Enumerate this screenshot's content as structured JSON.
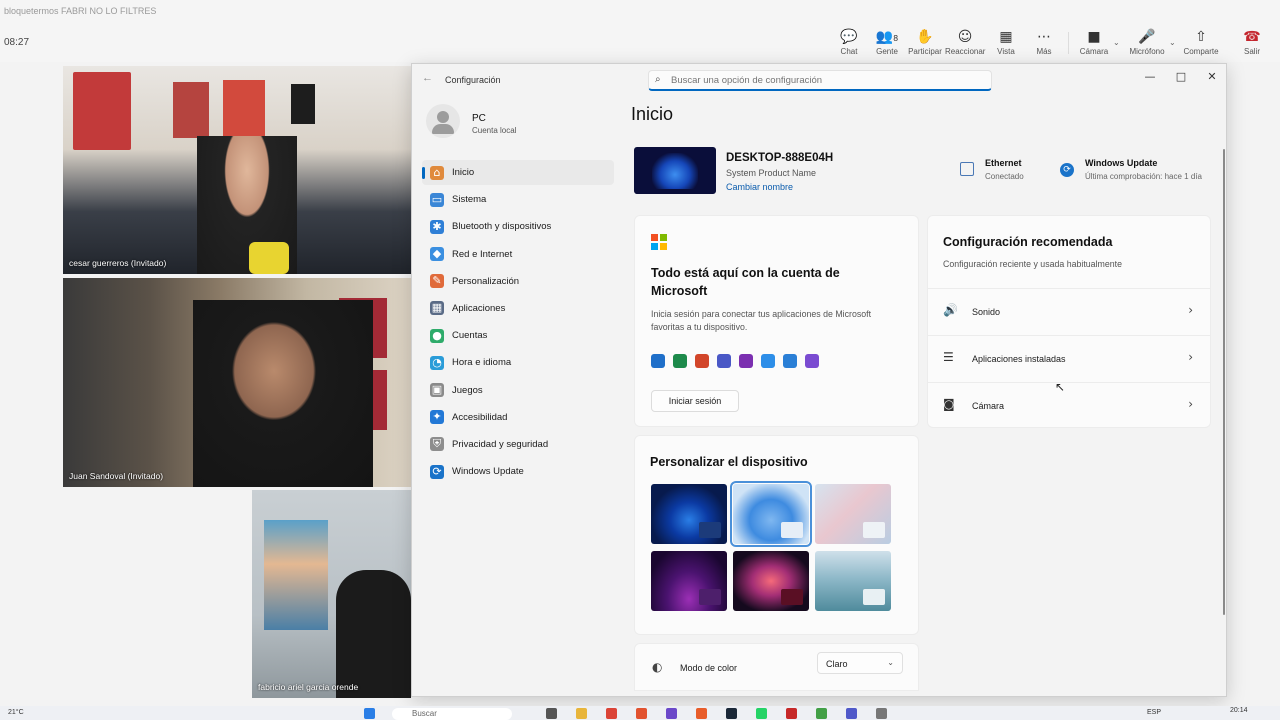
{
  "meeting": {
    "title": "bloquetermos FABRI NO LO FILTRES",
    "time": "08:27",
    "controls": [
      {
        "label": "Chat",
        "icon": "chat-icon",
        "glyph": "💬"
      },
      {
        "label": "Gente",
        "icon": "people-icon",
        "glyph": "👥",
        "count": "8"
      },
      {
        "label": "Participar",
        "icon": "raise-hand-icon",
        "glyph": "✋"
      },
      {
        "label": "Reaccionar",
        "icon": "emoji-icon",
        "glyph": "☺"
      },
      {
        "label": "Vista",
        "icon": "view-grid-icon",
        "glyph": "▦"
      },
      {
        "label": "Más",
        "icon": "more-icon",
        "glyph": "⋯"
      },
      {
        "label": "Cámara",
        "icon": "camera-icon",
        "glyph": "■"
      },
      {
        "label": "Micrófono",
        "icon": "microphone-icon",
        "glyph": "🎤"
      },
      {
        "label": "Comparte",
        "icon": "share-icon",
        "glyph": "⇧"
      },
      {
        "label": "Salir",
        "icon": "hangup-icon",
        "glyph": "☎"
      }
    ],
    "participants": [
      {
        "name": "cesar guerreros (Invitado)"
      },
      {
        "name": "Juan Sandoval (Invitado)"
      },
      {
        "name": "fabricio ariel garcia orende"
      }
    ]
  },
  "settings": {
    "app_title": "Configuración",
    "search_placeholder": "Buscar una opción de configuración",
    "user": {
      "name": "PC",
      "type": "Cuenta local"
    },
    "nav": [
      {
        "label": "Inicio",
        "icon": "home-icon",
        "color": "#e08a3c",
        "selected": true
      },
      {
        "label": "Sistema",
        "icon": "system-icon",
        "color": "#3a86d6"
      },
      {
        "label": "Bluetooth y dispositivos",
        "icon": "bluetooth-icon",
        "color": "#2f7fd6"
      },
      {
        "label": "Red e Internet",
        "icon": "network-icon",
        "color": "#3b8fe0"
      },
      {
        "label": "Personalización",
        "icon": "brush-icon",
        "color": "#e06a3a"
      },
      {
        "label": "Aplicaciones",
        "icon": "apps-icon",
        "color": "#5a6b86"
      },
      {
        "label": "Cuentas",
        "icon": "accounts-icon",
        "color": "#2eab6a"
      },
      {
        "label": "Hora e idioma",
        "icon": "time-language-icon",
        "color": "#2a9cd8"
      },
      {
        "label": "Juegos",
        "icon": "gaming-icon",
        "color": "#8a8a8a"
      },
      {
        "label": "Accesibilidad",
        "icon": "accessibility-icon",
        "color": "#2278d6"
      },
      {
        "label": "Privacidad y seguridad",
        "icon": "shield-icon",
        "color": "#8d8d8d"
      },
      {
        "label": "Windows Update",
        "icon": "windows-update-icon",
        "color": "#1a73c9"
      }
    ],
    "page_title": "Inicio",
    "device": {
      "name": "DESKTOP-888E04H",
      "model": "System Product Name",
      "rename": "Cambiar nombre"
    },
    "ethernet": {
      "label": "Ethernet",
      "status": "Conectado"
    },
    "windows_update": {
      "label": "Windows Update",
      "status": "Última comprobación: hace 1 día"
    },
    "microsoft_card": {
      "title": "Todo está aquí con la cuenta de Microsoft",
      "description": "Inicia sesión para conectar tus aplicaciones de Microsoft favoritas a tu dispositivo.",
      "button": "Iniciar sesión",
      "apps": [
        {
          "icon": "outlook-icon",
          "color": "#1f6fc9"
        },
        {
          "icon": "excel-icon",
          "color": "#1d8a4b"
        },
        {
          "icon": "powerpoint-icon",
          "color": "#d2462a"
        },
        {
          "icon": "teams-icon",
          "color": "#4a58c6"
        },
        {
          "icon": "onenote-icon",
          "color": "#7b2fb0"
        },
        {
          "icon": "onedrive-icon",
          "color": "#2d8ee8"
        },
        {
          "icon": "defender-icon",
          "color": "#2a7fd6"
        },
        {
          "icon": "clipchamp-icon",
          "color": "#7a4bd1"
        }
      ]
    },
    "recommended": {
      "title": "Configuración recomendada",
      "subtitle": "Configuración reciente y usada habitualmente",
      "items": [
        {
          "label": "Sonido",
          "icon": "speaker-icon",
          "glyph": "🔊"
        },
        {
          "label": "Aplicaciones instaladas",
          "icon": "list-icon",
          "glyph": "☰"
        },
        {
          "label": "Cámara",
          "icon": "camera-icon",
          "glyph": "◙"
        }
      ]
    },
    "personalize": {
      "title": "Personalizar el dispositivo",
      "themes": [
        {
          "name": "dark-bloom",
          "bg": "radial-gradient(ellipse at 50% 60%, #2a7ee6 0%, #0b3aa3 35%, #071a4d 70%)",
          "bar": "#1c3b7a",
          "selected": false
        },
        {
          "name": "light-bloom",
          "bg": "radial-gradient(ellipse at 50% 60%, #7fb7f0 0%, #3e8be0 40%, #cfe3f6 75%)",
          "bar": "#e6eef7",
          "selected": true
        },
        {
          "name": "flowers",
          "bg": "linear-gradient(135deg, #d6e3ef 0%, #e9c7cf 45%, #b9cde2 100%)",
          "bar": "#eef2f6",
          "selected": false
        },
        {
          "name": "glow",
          "bg": "radial-gradient(ellipse at 50% 80%, #9b2fb5 0%, #4b1370 40%, #1a0630 80%)",
          "bar": "#4d1f6b",
          "selected": false
        },
        {
          "name": "captured-motion",
          "bg": "radial-gradient(ellipse at 50% 50%, #f56a7a 0%, #a32e75 35%, #150a1e 75%)",
          "bar": "#5a0f24",
          "selected": false
        },
        {
          "name": "sunrise",
          "bg": "linear-gradient(180deg, #cfe0ea 0%, #8fb9c9 45%, #4f8b9c 100%)",
          "bar": "#e8f0f3",
          "selected": false
        }
      ]
    },
    "color_mode": {
      "label": "Modo de color",
      "value": "Claro"
    }
  },
  "taskbar": {
    "weather": "21°C",
    "search": "Buscar",
    "language": "ESP",
    "clock": "20:14"
  }
}
